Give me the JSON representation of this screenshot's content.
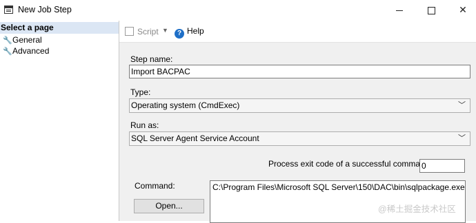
{
  "window": {
    "title": "New Job Step"
  },
  "left_pane": {
    "header": "Select a page",
    "items": [
      {
        "label": "General"
      },
      {
        "label": "Advanced"
      }
    ]
  },
  "toolbar": {
    "script_label": "Script",
    "help_label": "Help"
  },
  "form": {
    "step_name_label": "Step name:",
    "step_name_value": "Import BACPAC",
    "type_label": "Type:",
    "type_value": "Operating system (CmdExec)",
    "run_as_label": "Run as:",
    "run_as_value": "SQL Server Agent Service Account",
    "exit_code_label": "Process exit code of a successful command:",
    "exit_code_value": "0",
    "command_label": "Command:",
    "command_value": "C:\\Program Files\\Microsoft SQL Server\\150\\DAC\\bin\\sqlpackage.exe /A",
    "open_label": "Open..."
  },
  "watermark": "@稀土掘金技术社区"
}
